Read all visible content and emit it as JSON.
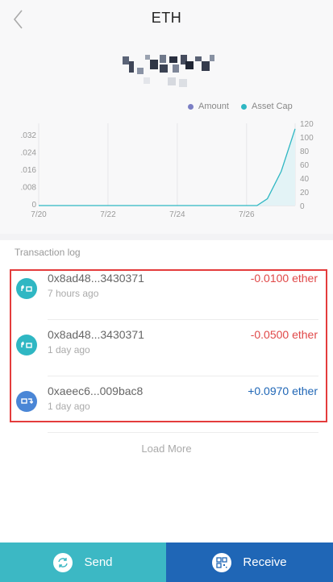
{
  "header": {
    "title": "ETH"
  },
  "chart_data": {
    "type": "line",
    "x_labels": [
      "7/20",
      "7/22",
      "7/24",
      "7/26"
    ],
    "left_axis_ticks": [
      ".032",
      ".024",
      ".016",
      ".008",
      "0"
    ],
    "right_axis_ticks": [
      "120",
      "100",
      "80",
      "60",
      "40",
      "20",
      "0"
    ],
    "legend": [
      {
        "name": "Amount",
        "color": "#7b7fc4"
      },
      {
        "name": "Asset Cap",
        "color": "#2fb7c3"
      }
    ],
    "series": [
      {
        "name": "Asset Cap",
        "axis": "right",
        "x": [
          0,
          1,
          2,
          3,
          4,
          5,
          6,
          6.3,
          6.6,
          7,
          7.4
        ],
        "values": [
          0,
          0,
          0,
          0,
          0,
          0,
          0,
          0,
          10,
          50,
          112
        ]
      }
    ],
    "ylim_left": [
      0,
      0.032
    ],
    "ylim_right": [
      0,
      120
    ]
  },
  "transactions": {
    "section_title": "Transaction log",
    "items": [
      {
        "hash": "0x8ad48...3430371",
        "time": "7 hours ago",
        "amount": "-0.0100 ether",
        "direction": "out",
        "amount_color": "#e04848",
        "icon": "send-icon",
        "icon_color": "#2fb7c3"
      },
      {
        "hash": "0x8ad48...3430371",
        "time": "1 day ago",
        "amount": "-0.0500 ether",
        "direction": "out",
        "amount_color": "#e04848",
        "icon": "send-icon",
        "icon_color": "#2fb7c3"
      },
      {
        "hash": "0xaeec6...009bac8",
        "time": "1 day ago",
        "amount": "+0.0970 ether",
        "direction": "in",
        "amount_color": "#1f66b6",
        "icon": "receive-icon",
        "icon_color": "#4a86d6"
      }
    ],
    "load_more": "Load More"
  },
  "footer": {
    "send_label": "Send",
    "receive_label": "Receive"
  }
}
